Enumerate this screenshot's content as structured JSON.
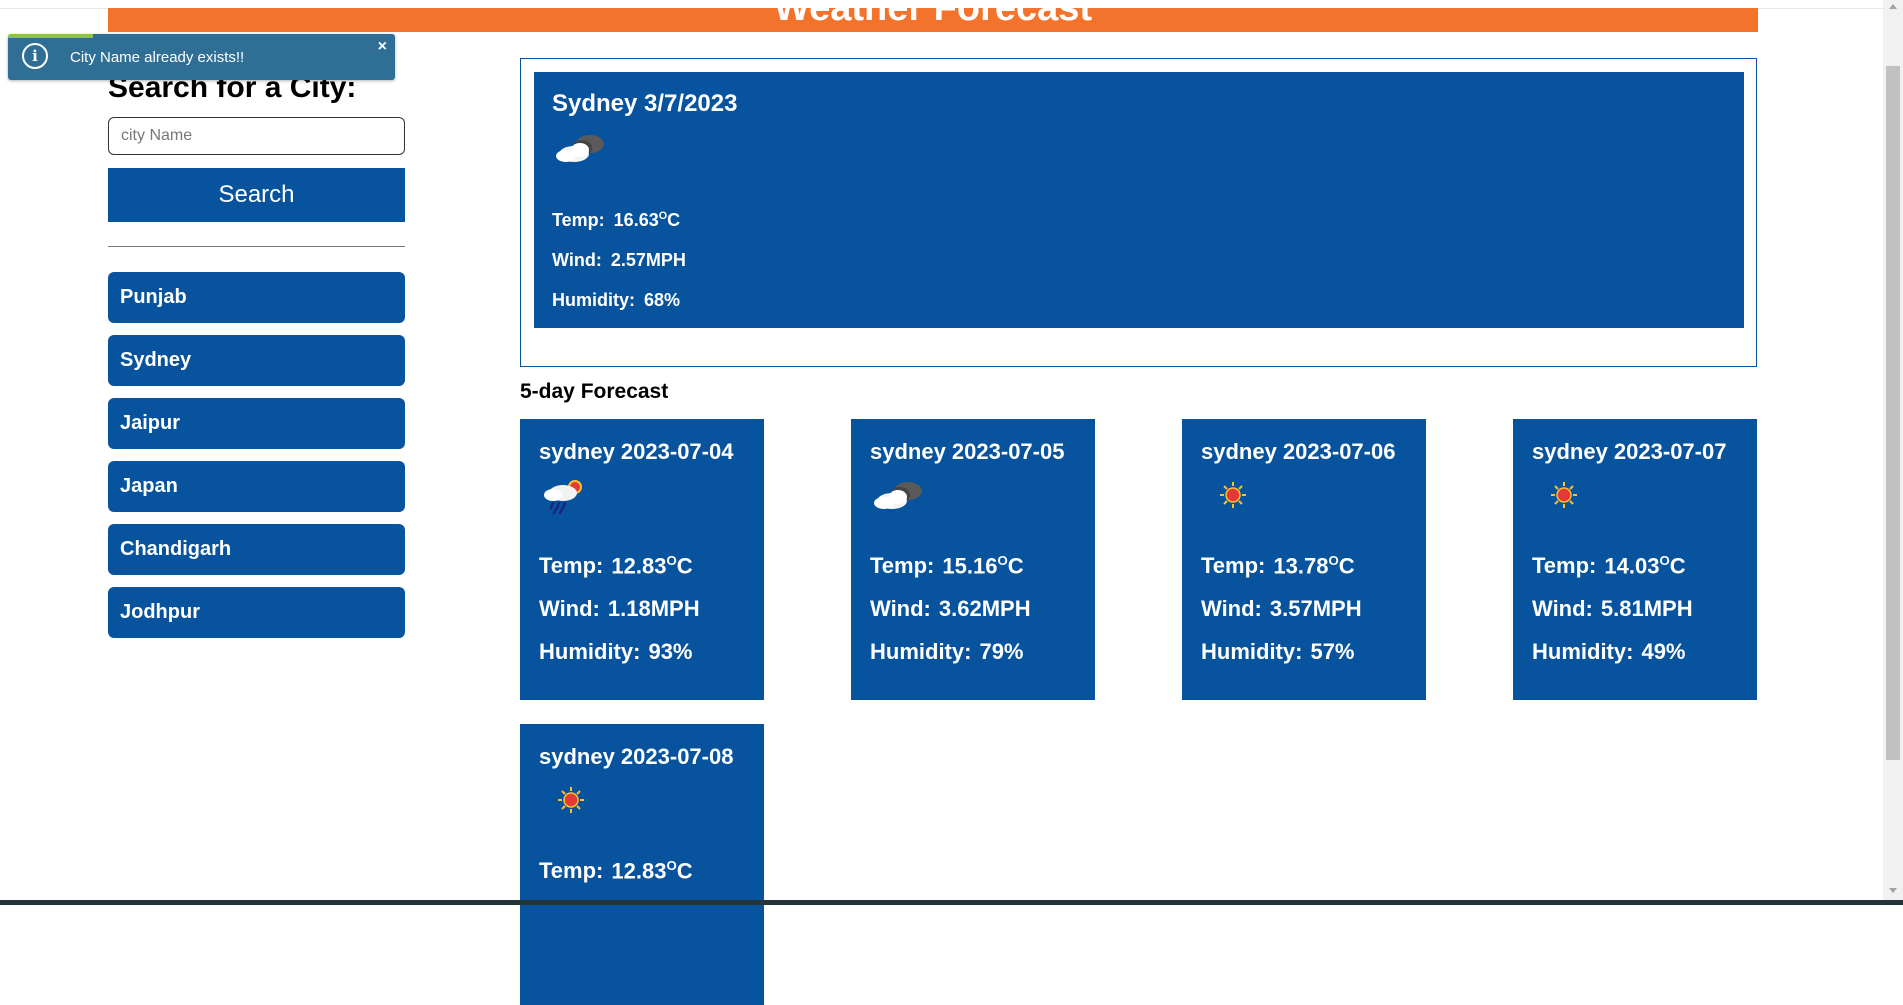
{
  "header": {
    "title": "Weather Forecast",
    "color": "#f3722c"
  },
  "toast": {
    "message": "City Name already exists!!",
    "close": "×",
    "icon": "info-icon"
  },
  "search": {
    "heading": "Search for a City:",
    "placeholder": "city Name",
    "button": "Search"
  },
  "cities": [
    "Punjab",
    "Sydney",
    "Jaipur",
    "Japan",
    "Chandigarh",
    "Jodhpur"
  ],
  "current": {
    "title": "Sydney 3/7/2023",
    "icon": "cloudy-icon",
    "temp_label": "Temp:",
    "temp": "16.63",
    "temp_unit": "C",
    "wind_label": "Wind:",
    "wind": "2.57MPH",
    "humidity_label": "Humidity:",
    "humidity": "68%"
  },
  "forecast_heading": "5-day Forecast",
  "forecast": [
    {
      "title": "sydney 2023-07-04",
      "icon": "rain-sun-icon",
      "temp": "12.83",
      "wind": "1.18MPH",
      "humidity": "93%"
    },
    {
      "title": "sydney 2023-07-05",
      "icon": "cloudy-icon",
      "temp": "15.16",
      "wind": "3.62MPH",
      "humidity": "79%"
    },
    {
      "title": "sydney 2023-07-06",
      "icon": "sun-icon",
      "temp": "13.78",
      "wind": "3.57MPH",
      "humidity": "57%"
    },
    {
      "title": "sydney 2023-07-07",
      "icon": "sun-icon",
      "temp": "14.03",
      "wind": "5.81MPH",
      "humidity": "49%"
    },
    {
      "title": "sydney 2023-07-08",
      "icon": "sun-icon",
      "temp": "12.83",
      "wind": "",
      "humidity": ""
    }
  ],
  "labels": {
    "temp": "Temp:",
    "wind": "Wind:",
    "humidity": "Humidity:",
    "deg": "O",
    "unit": "C"
  },
  "colors": {
    "primary": "#07539e",
    "toast": "#2f6f95",
    "accent": "#f3722c"
  }
}
